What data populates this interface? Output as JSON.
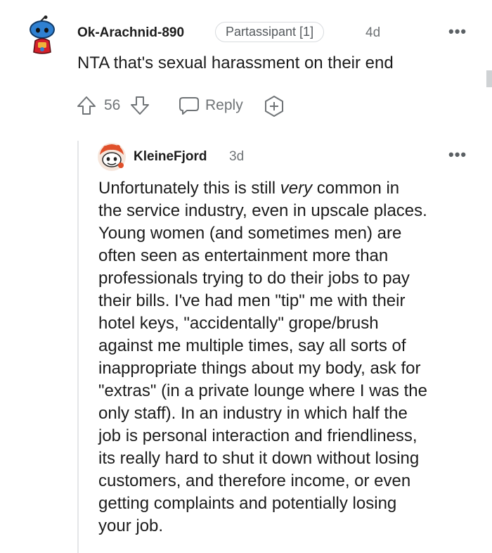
{
  "comment": {
    "username": "Ok-Arachnid-890",
    "flair": "Partassipant [1]",
    "age": "4d",
    "more_label": "•••",
    "body": "NTA that's sexual harassment on their end",
    "votes": "56",
    "reply_label": "Reply"
  },
  "reply": {
    "username": "KleineFjord",
    "age": "3d",
    "more_label": "•••",
    "lines": [
      {
        "pre": "Unfortunately this is still ",
        "em": "very",
        "post": " common in"
      },
      {
        "pre": "the service industry, even in upscale places.",
        "em": "",
        "post": ""
      },
      {
        "pre": "Young women (and sometimes men) are",
        "em": "",
        "post": ""
      },
      {
        "pre": "often seen as entertainment more than",
        "em": "",
        "post": ""
      },
      {
        "pre": "professionals trying to do their jobs to pay",
        "em": "",
        "post": ""
      },
      {
        "pre": "their bills. I've had men \"tip\" me with their",
        "em": "",
        "post": ""
      },
      {
        "pre": "hotel keys, \"accidentally\" grope/brush",
        "em": "",
        "post": ""
      },
      {
        "pre": "against me multiple times, say all sorts of",
        "em": "",
        "post": ""
      },
      {
        "pre": "inappropriate things about my body, ask for",
        "em": "",
        "post": ""
      },
      {
        "pre": "\"extras\" (in a private lounge where I was the",
        "em": "",
        "post": ""
      },
      {
        "pre": "only staff). In an industry in which half the",
        "em": "",
        "post": ""
      },
      {
        "pre": "job is personal interaction and friendliness,",
        "em": "",
        "post": ""
      },
      {
        "pre": "its really hard to shut it down without losing",
        "em": "",
        "post": ""
      },
      {
        "pre": "customers, and therefore income, or even",
        "em": "",
        "post": ""
      },
      {
        "pre": "getting complaints and potentially losing",
        "em": "",
        "post": ""
      },
      {
        "pre": "your job.",
        "em": "",
        "post": ""
      }
    ]
  },
  "icons": {
    "upvote": "upvote-arrow-icon",
    "downvote": "downvote-arrow-icon",
    "reply": "chat-bubble-icon",
    "award": "award-plus-icon"
  },
  "colors": {
    "text": "#1c1c1c",
    "muted": "#6f7376",
    "thread_line": "#e4e6e8"
  }
}
